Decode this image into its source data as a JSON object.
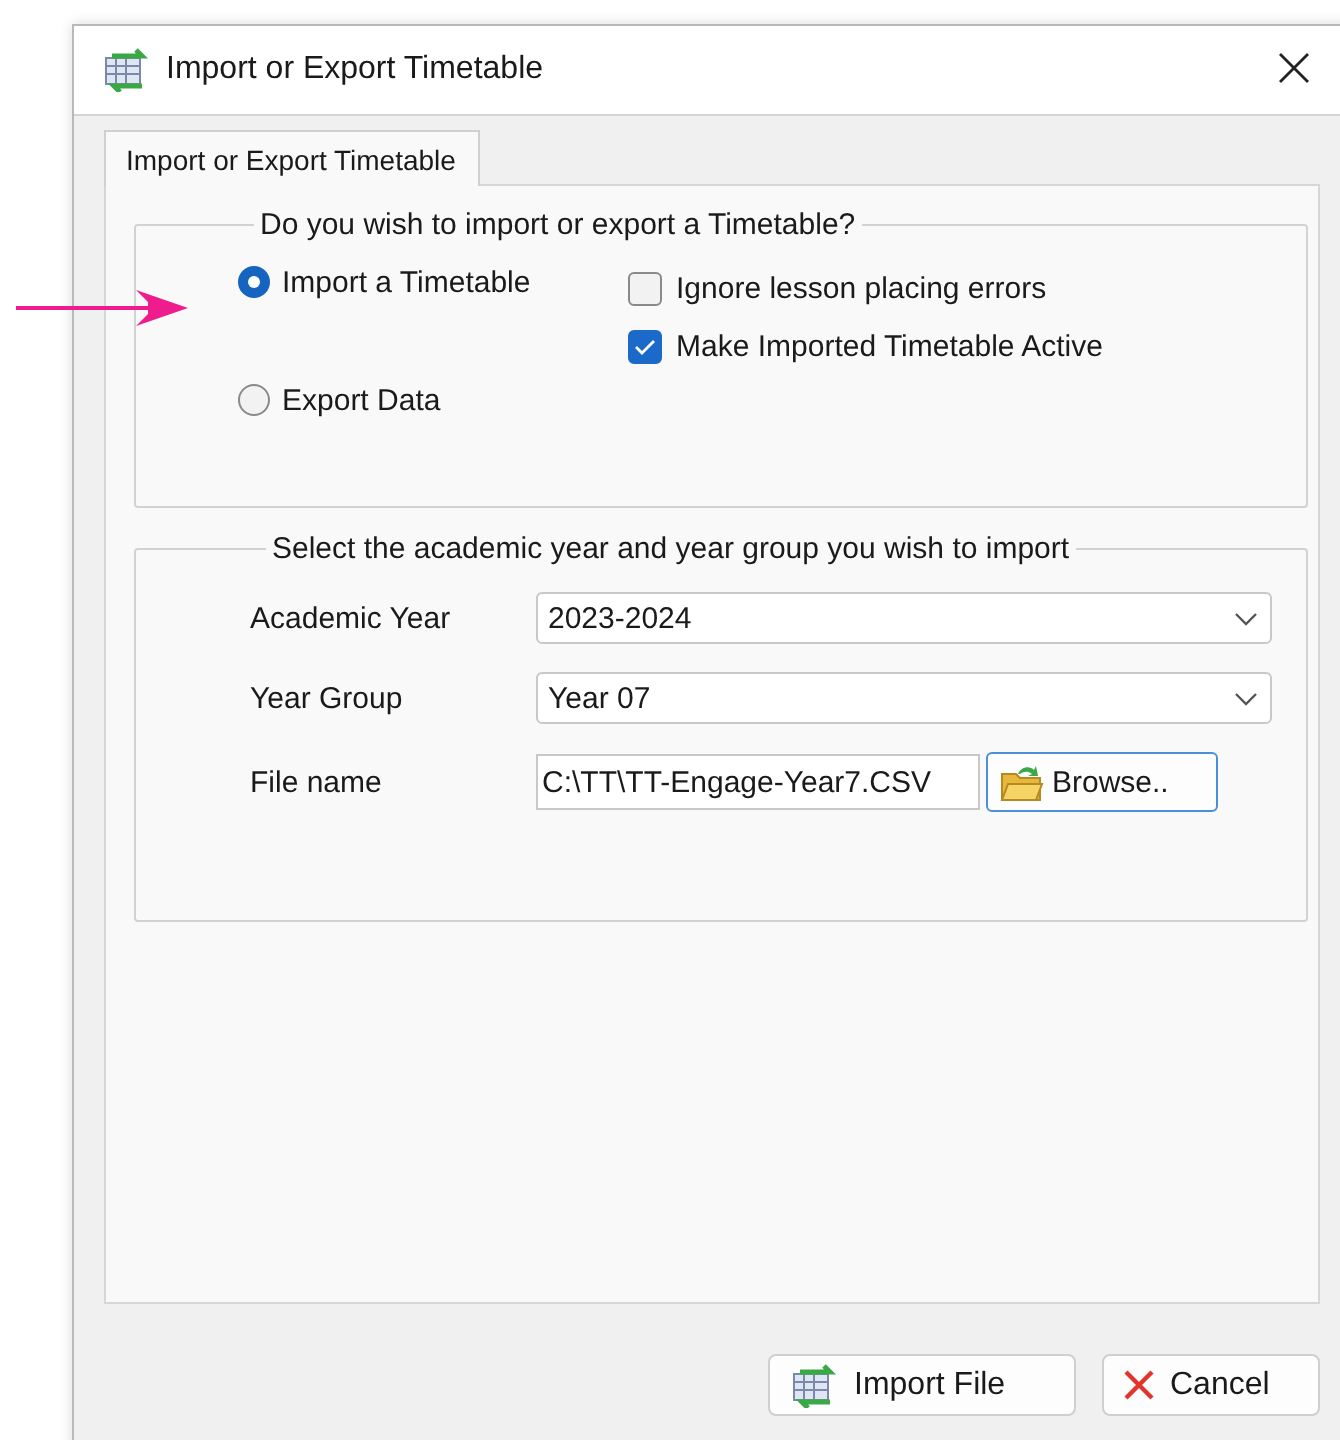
{
  "window": {
    "title": "Import or Export Timetable"
  },
  "tabs": [
    {
      "label": "Import or Export Timetable",
      "selected": true
    }
  ],
  "mode_group": {
    "legend": "Do you wish to import or export a Timetable?",
    "options": [
      {
        "label": "Import a Timetable",
        "selected": true
      },
      {
        "label": "Export Data",
        "selected": false
      }
    ],
    "checkboxes": [
      {
        "label": "Ignore lesson placing errors",
        "checked": false
      },
      {
        "label": "Make Imported Timetable Active",
        "checked": true
      }
    ]
  },
  "select_group": {
    "legend": "Select the academic year and year group you wish to import",
    "fields": [
      {
        "kind": "dropdown",
        "label": "Academic Year",
        "value": "2023-2024"
      },
      {
        "kind": "dropdown",
        "label": "Year Group",
        "value": "Year 07"
      },
      {
        "kind": "file",
        "label": "File name",
        "value": "C:\\TT\\TT-Engage-Year7.CSV",
        "button": "Browse.."
      }
    ]
  },
  "buttons": [
    {
      "kind": "import",
      "label": "Import File"
    },
    {
      "kind": "cancel",
      "label": "Cancel"
    }
  ]
}
